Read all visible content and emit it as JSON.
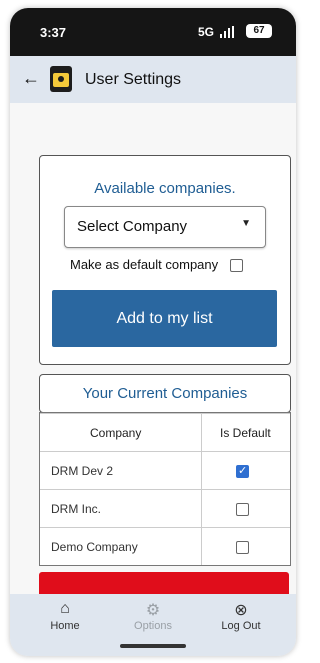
{
  "status_bar": {
    "time": "3:37",
    "network": "5G",
    "battery": "67"
  },
  "app_bar": {
    "title": "User Settings"
  },
  "available": {
    "heading": "Available companies.",
    "select_value": "Select Company",
    "default_label": "Make as default company",
    "default_checked": false,
    "add_button": "Add to my list"
  },
  "current": {
    "heading": "Your Current Companies",
    "columns": [
      "Company",
      "Is Default"
    ],
    "rows": [
      {
        "company": "DRM Dev 2",
        "is_default": true
      },
      {
        "company": "DRM Inc.",
        "is_default": false
      },
      {
        "company": "Demo Company",
        "is_default": false
      }
    ]
  },
  "bottom_nav": {
    "items": [
      {
        "label": "Home",
        "icon": "home-icon"
      },
      {
        "label": "Options",
        "icon": "user-settings-icon"
      },
      {
        "label": "Log Out",
        "icon": "close-circle-icon"
      }
    ]
  },
  "colors": {
    "accent": "#2a67a0",
    "danger": "#e00d1b",
    "header_bg": "#dfe6ef"
  }
}
